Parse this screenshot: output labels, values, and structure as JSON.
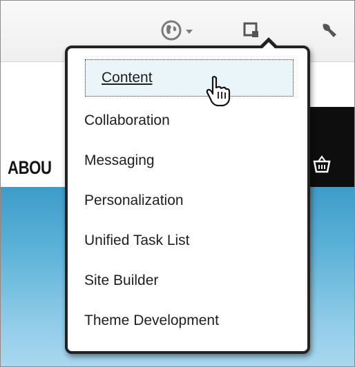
{
  "toolbar": {
    "icons": [
      "globe-icon",
      "square-icon",
      "wrench-icon"
    ]
  },
  "nav": {
    "partial_label": "ABOU"
  },
  "menu": {
    "items": [
      {
        "label": "Content",
        "selected": true
      },
      {
        "label": "Collaboration"
      },
      {
        "label": "Messaging"
      },
      {
        "label": "Personalization"
      },
      {
        "label": "Unified Task List"
      },
      {
        "label": "Site Builder"
      },
      {
        "label": "Theme Development"
      }
    ]
  },
  "colors": {
    "menu_border": "#222222",
    "highlight_bg": "#eaf5fa",
    "blue_banner": "#5cb2d8",
    "nav_dark": "#0e0e0e"
  }
}
